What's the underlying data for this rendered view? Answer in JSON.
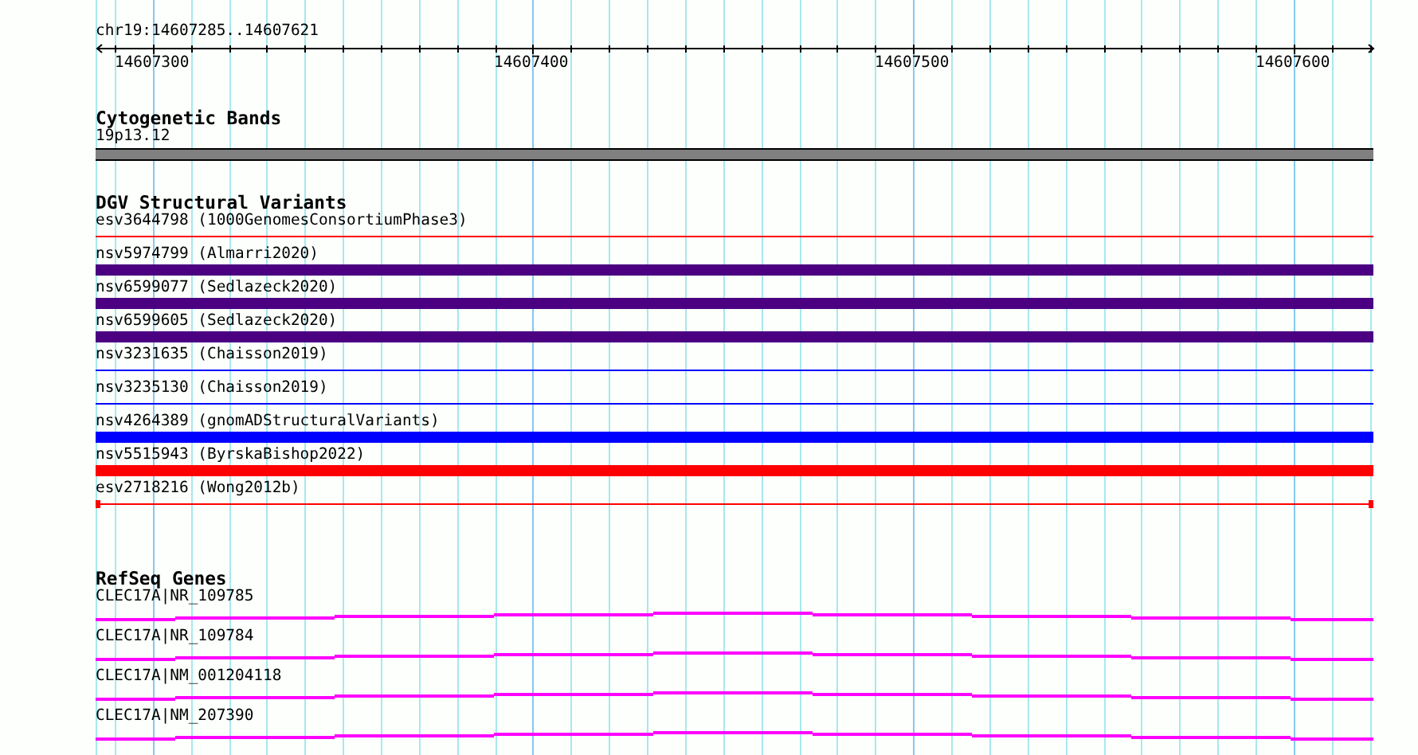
{
  "ruler": {
    "region": "chr19:14607285..14607621",
    "tick_labels": [
      "14607300",
      "14607400",
      "14607500",
      "14607600"
    ]
  },
  "tracks": [
    {
      "kind": "band",
      "title": "Cytogenetic Bands",
      "features": [
        {
          "label": "19p13.12",
          "color": "#808080"
        }
      ]
    },
    {
      "kind": "variants",
      "title": "DGV Structural Variants",
      "features": [
        {
          "label": "esv3644798 (1000GenomesConsortiumPhase3)",
          "kind": "thin",
          "color": "#ff0000"
        },
        {
          "label": "nsv5974799 (Almarri2020)",
          "kind": "thick",
          "color": "#4b0082"
        },
        {
          "label": "nsv6599077 (Sedlazeck2020)",
          "kind": "thick",
          "color": "#4b0082"
        },
        {
          "label": "nsv6599605 (Sedlazeck2020)",
          "kind": "thick",
          "color": "#4b0082"
        },
        {
          "label": "nsv3231635 (Chaisson2019)",
          "kind": "thin",
          "color": "#0000ff"
        },
        {
          "label": "nsv3235130 (Chaisson2019)",
          "kind": "thin",
          "color": "#0000ff"
        },
        {
          "label": "nsv4264389 (gnomADStructuralVariants)",
          "kind": "thick",
          "color": "#0000ff"
        },
        {
          "label": "nsv5515943 (ByrskaBishop2022)",
          "kind": "thick",
          "color": "#ff0000"
        },
        {
          "label": "esv2718216 (Wong2012b)",
          "kind": "capped",
          "color": "#ff0000"
        }
      ]
    },
    {
      "kind": "genes",
      "title": "RefSeq Genes",
      "features": [
        {
          "label": "CLEC17A|NR_109785"
        },
        {
          "label": "CLEC17A|NR_109784"
        },
        {
          "label": "CLEC17A|NM_001204118"
        },
        {
          "label": "CLEC17A|NM_207390"
        }
      ]
    }
  ]
}
